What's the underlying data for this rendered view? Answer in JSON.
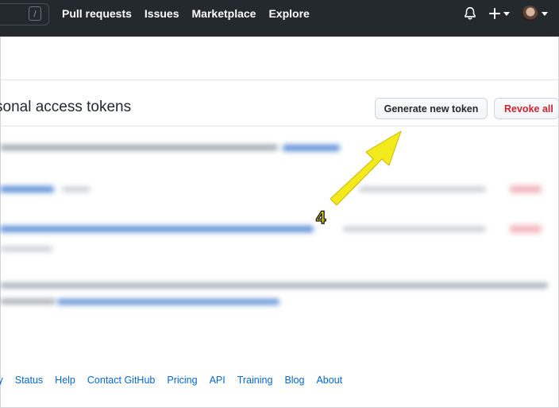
{
  "header": {
    "search_key_hint": "/",
    "nav": [
      "Pull requests",
      "Issues",
      "Marketplace",
      "Explore"
    ],
    "icons": [
      "bell-icon",
      "plus-icon",
      "avatar"
    ]
  },
  "main": {
    "title": "sonal access tokens",
    "generate_button": "Generate new token",
    "revoke_button": "Revoke all"
  },
  "annotation": {
    "step_number": "4",
    "arrow_color": "#f2ea1c"
  },
  "footer": {
    "links": [
      "ty",
      "Status",
      "Help",
      "Contact GitHub",
      "Pricing",
      "API",
      "Training",
      "Blog",
      "About"
    ]
  },
  "colors": {
    "header_bg": "#24292e",
    "link": "#0366d6",
    "danger": "#cb2431"
  }
}
